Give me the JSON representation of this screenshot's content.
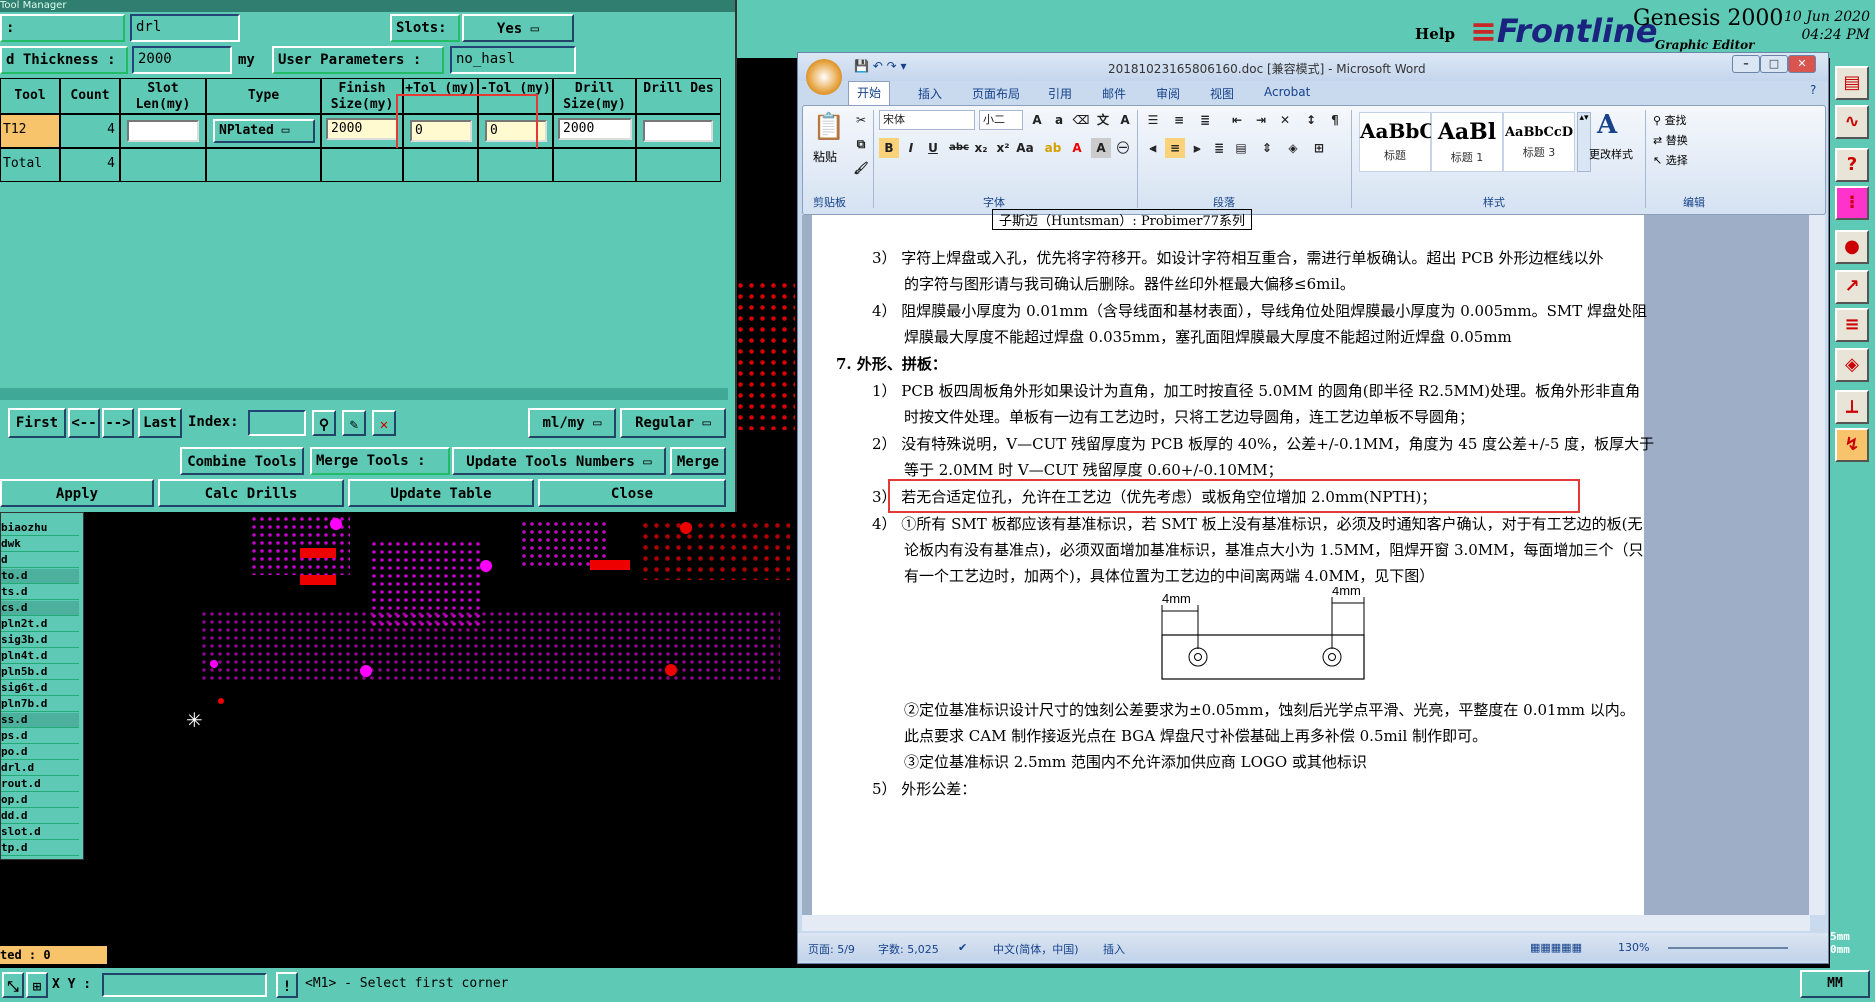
{
  "genesis": {
    "help_label": "Help",
    "logo": "Frontline",
    "product": "Genesis 2000",
    "subtitle": "Graphic Editor",
    "date": "10 Jun 2020",
    "time": "04:24 PM"
  },
  "tool_manager": {
    "window_title": "Tool Manager",
    "row1": {
      "colon": ":",
      "value": "drl",
      "slots_label": "Slots:",
      "slots_value": "Yes"
    },
    "row2": {
      "thickness_label": "d Thickness :",
      "thickness_value": "2000",
      "unit": "my",
      "params_label": "User Parameters :",
      "params_value": "no_hasl"
    },
    "columns": [
      "Tool",
      "Count",
      "Slot Len(my)",
      "Type",
      "Finish Size(my)",
      "+Tol (my)",
      "-Tol (my)",
      "Drill Size(my)",
      "Drill Des"
    ],
    "rows": [
      {
        "tool": "T12",
        "count": "4",
        "slot_len": "",
        "type": "NPlated",
        "finish": "2000",
        "plus_tol": "0",
        "minus_tol": "0",
        "drill": "2000",
        "des": ""
      },
      {
        "tool": "Total",
        "count": "4"
      }
    ],
    "nav": {
      "first": "First",
      "prev": "<--",
      "next": "-->",
      "last": "Last",
      "index_label": "Index:",
      "units": "ml/my",
      "mode": "Regular"
    },
    "tools_row": {
      "combine": "Combine Tools",
      "merge_label": "Merge Tools :",
      "update_numbers": "Update Tools Numbers",
      "merge": "Merge"
    },
    "actions": {
      "apply": "Apply",
      "calc": "Calc Drills",
      "update": "Update Table",
      "close": "Close"
    }
  },
  "layers": [
    "biaozhu",
    "dwk",
    "d",
    "to.d",
    "ts.d",
    "cs.d",
    "pln2t.d",
    "sig3b.d",
    "pln4t.d",
    "pln5b.d",
    "sig6t.d",
    "pln7b.d",
    "ss.d",
    "ps.d",
    "po.d",
    "drl.d",
    "rout.d",
    "op.d",
    "dd.d",
    "slot.d",
    "tp.d"
  ],
  "status": {
    "selected": "ted : 0",
    "xy_label": "X Y :",
    "message": "<M1> - Select first corner",
    "units": "MM",
    "side_units": [
      "5mm",
      "0mm"
    ]
  },
  "word": {
    "title": "20181023165806160.doc [兼容模式] - Microsoft Word",
    "tabs": [
      "开始",
      "插入",
      "页面布局",
      "引用",
      "邮件",
      "审阅",
      "视图",
      "Acrobat"
    ],
    "font_name": "宋体",
    "font_size": "小二",
    "paste_label": "粘贴",
    "groups": [
      "剪贴板",
      "字体",
      "段落",
      "样式",
      "编辑"
    ],
    "styles": [
      {
        "sample": "AaBbC",
        "name": "标题"
      },
      {
        "sample": "AaBl",
        "name": "标题 1"
      },
      {
        "sample": "AaBbCcD",
        "name": "标题 3"
      }
    ],
    "change_styles": "更改样式",
    "edit": {
      "find": "查找",
      "replace": "替换",
      "select": "选择"
    },
    "statusbar": {
      "page": "页面: 5/9",
      "words": "字数: 5,025",
      "lang": "中文(简体，中国)",
      "mode": "插入",
      "zoom": "130%"
    },
    "doc": {
      "top_cut": "子斯迈（Huntsman）: Probimer77系列",
      "l1": "3）  字符上焊盘或入孔，优先将字符移开。如设计字符相互重合，需进行单板确认。超出 PCB 外形边框线以外",
      "l2": "的字符与图形请与我司确认后删除。器件丝印外框最大偏移≤6mil。",
      "l3": "4）  阻焊膜最小厚度为 0.01mm（含导线面和基材表面），导线角位处阻焊膜最小厚度为 0.005mm。SMT 焊盘处阻",
      "l4": "焊膜最大厚度不能超过焊盘 0.035mm，塞孔面阻焊膜最大厚度不能超过附近焊盘 0.05mm",
      "h7": "7.   外形、拼板：",
      "l5": "1）  PCB 板四周板角外形如果设计为直角，加工时按直径 5.0MM 的圆角(即半径 R2.5MM)处理。板角外形非直角",
      "l6": "时按文件处理。单板有一边有工艺边时，只将工艺边导圆角，连工艺边单板不导圆角；",
      "l7": "2）  没有特殊说明，V—CUT 残留厚度为 PCB 板厚的 40%，公差+/-0.1MM，角度为 45 度公差+/-5 度，板厚大于",
      "l8": "等于 2.0MM 时 V—CUT 残留厚度 0.60+/-0.10MM；",
      "l9": "3）  若无合适定位孔，允许在工艺边（优先考虑）或板角空位增加 2.0mm(NPTH)；",
      "l10": "4）  ①所有 SMT 板都应该有基准标识，若 SMT 板上没有基准标识，必须及时通知客户确认，对于有工艺边的板(无",
      "l11": "论板内有没有基准点)，必须双面增加基准标识，基准点大小为 1.5MM，阻焊开窗 3.0MM，每面增加三个（只",
      "l12": "有一个工艺边时，加两个)，具体位置为工艺边的中间离两端 4.0MM，见下图）",
      "dim1": "4mm",
      "dim2": "4mm",
      "l13": "②定位基准标识设计尺寸的蚀刻公差要求为±0.05mm，蚀刻后光学点平滑、光亮，平整度在 0.01mm 以内。",
      "l14": "此点要求 CAM 制作接返光点在 BGA 焊盘尺寸补偿基础上再多补偿 0.5mil 制作即可。",
      "l15": "③定位基准标识 2.5mm 范围内不允许添加供应商 LOGO 或其他标识",
      "l16": "5）  外形公差："
    }
  }
}
